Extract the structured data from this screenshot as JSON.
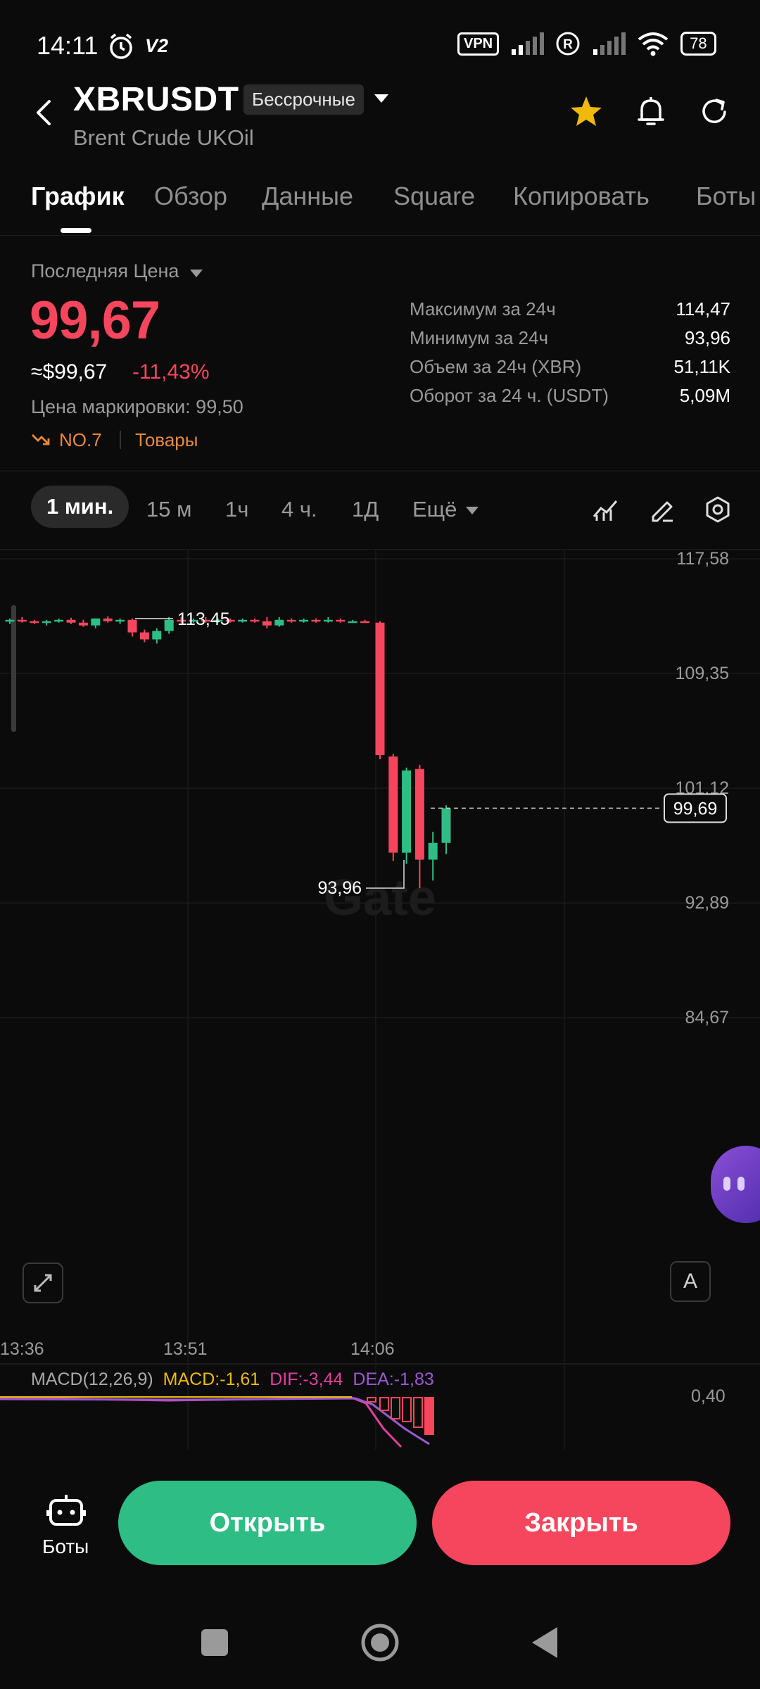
{
  "status_bar": {
    "time": "14:11",
    "v2_label": "V2",
    "vpn_label": "VPN",
    "battery": "78",
    "icons": [
      "alarm-icon",
      "signal-icon",
      "roaming-icon",
      "signal-icon",
      "wifi-icon",
      "battery-icon"
    ]
  },
  "header": {
    "symbol": "XBRUSDT",
    "contract_type": "Бессрочные",
    "subtitle": "Brent Crude UKOil",
    "icons": [
      "back-icon",
      "star-icon",
      "bell-icon",
      "share-icon"
    ],
    "star_color": "#f0b90b"
  },
  "tabs": [
    {
      "label": "График",
      "active": true
    },
    {
      "label": "Обзор",
      "active": false
    },
    {
      "label": "Данные",
      "active": false
    },
    {
      "label": "Square",
      "active": false
    },
    {
      "label": "Копировать",
      "active": false
    },
    {
      "label": "Боты",
      "active": false
    }
  ],
  "price": {
    "label": "Последняя Цена",
    "last": "99,67",
    "usd": "≈$99,67",
    "change": "-11,43%",
    "mark_price": "Цена маркировки: 99,50",
    "rank": "NO.7",
    "category": "Товары",
    "down_color": "#f6465d",
    "up_color": "#2ebd85"
  },
  "stats": [
    {
      "label": "Максимум за 24ч",
      "value": "114,47"
    },
    {
      "label": "Минимум за 24ч",
      "value": "93,96"
    },
    {
      "label": "Объем за 24ч (XBR)",
      "value": "51,11K"
    },
    {
      "label": "Оборот за 24 ч. (USDT)",
      "value": "5,09M"
    }
  ],
  "timeframes": {
    "items": [
      "1 мин.",
      "15 м",
      "1ч",
      "4 ч.",
      "1Д"
    ],
    "active": "1 мин.",
    "more": "Ещё",
    "tool_icons": [
      "indicator-icon",
      "draw-icon",
      "settings-icon"
    ]
  },
  "chart": {
    "watermark": "Gate",
    "last_price_tag": "99,69",
    "high_marker": "113,45",
    "low_marker": "93,96",
    "auto_label": "A",
    "macd": {
      "name": "MACD(12,26,9)",
      "macd": "MACD:-1,61",
      "dif": "DIF:-3,44",
      "dea": "DEA:-1,83",
      "axis_value": "0,40",
      "macd_color": "#f0b90b",
      "dif_color": "#e040a0",
      "dea_color": "#9b59d0"
    }
  },
  "chart_data": {
    "type": "candlestick",
    "y_ticks": [
      "117,58",
      "109,35",
      "101,12",
      "92,89",
      "84,67"
    ],
    "x_ticks": [
      "13:36",
      "13:51",
      "14:06"
    ],
    "ylim": [
      84.67,
      117.58
    ],
    "candles": [
      {
        "o": 113.1,
        "h": 113.3,
        "l": 112.9,
        "c": 113.2
      },
      {
        "o": 113.2,
        "h": 113.4,
        "l": 113.0,
        "c": 113.1
      },
      {
        "o": 113.1,
        "h": 113.2,
        "l": 112.9,
        "c": 113.0
      },
      {
        "o": 113.0,
        "h": 113.2,
        "l": 112.8,
        "c": 113.1
      },
      {
        "o": 113.1,
        "h": 113.3,
        "l": 113.0,
        "c": 113.2
      },
      {
        "o": 113.2,
        "h": 113.35,
        "l": 112.9,
        "c": 113.0
      },
      {
        "o": 113.0,
        "h": 113.2,
        "l": 112.7,
        "c": 112.8
      },
      {
        "o": 112.8,
        "h": 113.3,
        "l": 112.6,
        "c": 113.3
      },
      {
        "o": 113.3,
        "h": 113.45,
        "l": 113.0,
        "c": 113.1
      },
      {
        "o": 113.1,
        "h": 113.3,
        "l": 112.9,
        "c": 113.2
      },
      {
        "o": 113.2,
        "h": 113.3,
        "l": 112.0,
        "c": 112.3
      },
      {
        "o": 112.3,
        "h": 112.5,
        "l": 111.6,
        "c": 111.8
      },
      {
        "o": 111.8,
        "h": 112.6,
        "l": 111.5,
        "c": 112.4
      },
      {
        "o": 112.4,
        "h": 113.4,
        "l": 112.2,
        "c": 113.2
      },
      {
        "o": 113.2,
        "h": 113.4,
        "l": 113.0,
        "c": 113.1
      },
      {
        "o": 113.1,
        "h": 113.3,
        "l": 113.0,
        "c": 113.2
      },
      {
        "o": 113.2,
        "h": 113.4,
        "l": 113.0,
        "c": 113.1
      },
      {
        "o": 113.1,
        "h": 113.3,
        "l": 113.0,
        "c": 113.2
      },
      {
        "o": 113.2,
        "h": 113.3,
        "l": 113.0,
        "c": 113.1
      },
      {
        "o": 113.1,
        "h": 113.3,
        "l": 113.0,
        "c": 113.2
      },
      {
        "o": 113.2,
        "h": 113.3,
        "l": 113.0,
        "c": 113.1
      },
      {
        "o": 113.1,
        "h": 113.4,
        "l": 112.6,
        "c": 112.8
      },
      {
        "o": 112.8,
        "h": 113.4,
        "l": 112.7,
        "c": 113.2
      },
      {
        "o": 113.2,
        "h": 113.3,
        "l": 113.0,
        "c": 113.1
      },
      {
        "o": 113.1,
        "h": 113.3,
        "l": 113.0,
        "c": 113.2
      },
      {
        "o": 113.2,
        "h": 113.3,
        "l": 113.0,
        "c": 113.1
      },
      {
        "o": 113.1,
        "h": 113.4,
        "l": 113.0,
        "c": 113.2
      },
      {
        "o": 113.2,
        "h": 113.3,
        "l": 113.0,
        "c": 113.1
      },
      {
        "o": 113.1,
        "h": 113.2,
        "l": 113.0,
        "c": 113.1
      },
      {
        "o": 113.1,
        "h": 113.2,
        "l": 113.0,
        "c": 113.0
      },
      {
        "o": 113.0,
        "h": 113.1,
        "l": 103.2,
        "c": 103.5
      },
      {
        "o": 103.4,
        "h": 103.6,
        "l": 95.9,
        "c": 96.5
      },
      {
        "o": 96.5,
        "h": 102.6,
        "l": 95.7,
        "c": 102.4
      },
      {
        "o": 102.5,
        "h": 102.8,
        "l": 93.96,
        "c": 96.0
      },
      {
        "o": 96.0,
        "h": 98.0,
        "l": 94.5,
        "c": 97.2
      },
      {
        "o": 97.2,
        "h": 99.9,
        "l": 96.4,
        "c": 99.69
      }
    ]
  },
  "bottom_bar": {
    "bots_label": "Боты",
    "open_label": "Открыть",
    "close_label": "Закрыть"
  },
  "nav_bar": {
    "icons": [
      "recents-icon",
      "home-icon",
      "back-nav-icon"
    ]
  }
}
